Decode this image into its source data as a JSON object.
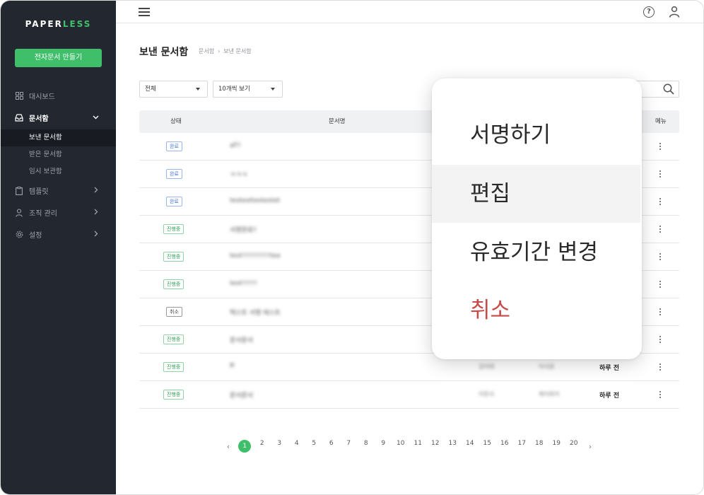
{
  "app": {
    "logo_main": "PAPER",
    "logo_accent": "LESS",
    "create_button": "전자문서 만들기"
  },
  "sidebar": {
    "items": [
      {
        "label": "대시보드",
        "icon": "dashboard-icon"
      },
      {
        "label": "문서함",
        "icon": "inbox-icon",
        "open": true
      },
      {
        "label": "템플릿",
        "icon": "clipboard-icon"
      },
      {
        "label": "조직 관리",
        "icon": "person-icon"
      },
      {
        "label": "설정",
        "icon": "gear-icon"
      }
    ],
    "sub_items": [
      {
        "label": "보낸 문서함",
        "active": true
      },
      {
        "label": "받은 문서함"
      },
      {
        "label": "임시 보관함"
      }
    ]
  },
  "topbar": {
    "help_symbol": "?"
  },
  "page": {
    "title": "보낸 문서함",
    "breadcrumb": [
      "문서함",
      "보낸 문서함"
    ]
  },
  "filters": {
    "status_select": "전체",
    "page_size_select": "10개씩 보기"
  },
  "table": {
    "headers": {
      "status": "상태",
      "name": "문서명",
      "menu": "메뉴"
    },
    "rows": [
      {
        "status": "완료",
        "kind": "done",
        "name": "af!!",
        "c3": "",
        "c4": "",
        "when": ""
      },
      {
        "status": "완료",
        "kind": "done",
        "name": "ㅋㅋㅋ",
        "c3": "",
        "c4": "",
        "when": ""
      },
      {
        "status": "완료",
        "kind": "done",
        "name": "testesttestestet",
        "c3": "",
        "c4": "",
        "when": ""
      },
      {
        "status": "진행중",
        "kind": "prog",
        "name": "서명완료?",
        "c3": "",
        "c4": "",
        "when": ""
      },
      {
        "status": "진행중",
        "kind": "prog",
        "name": "test!!!!!!!!!!!tea",
        "c3": "",
        "c4": "",
        "when": ""
      },
      {
        "status": "진행중",
        "kind": "prog",
        "name": "test!!!!!!",
        "c3": "",
        "c4": "",
        "when": ""
      },
      {
        "status": "취소",
        "kind": "cancel",
        "name": "텍스트 서명 테스트",
        "c3": "",
        "c4": "",
        "when": ""
      },
      {
        "status": "진행중",
        "kind": "prog",
        "name": "문서문서",
        "c3": "",
        "c4": "",
        "when": ""
      },
      {
        "status": "진행중",
        "kind": "prog",
        "name": "ff",
        "c3": "김이테",
        "c4": "이사원",
        "when": "하루 전"
      },
      {
        "status": "진행중",
        "kind": "prog",
        "name": "문서문서",
        "c3": "이문서",
        "c4": "제이파이",
        "when": "하루 전"
      }
    ]
  },
  "pagination": {
    "prev": "‹",
    "next": "›",
    "pages": [
      "1",
      "2",
      "3",
      "4",
      "5",
      "6",
      "7",
      "8",
      "9",
      "10",
      "11",
      "12",
      "13",
      "14",
      "15",
      "16",
      "17",
      "18",
      "19",
      "20"
    ],
    "current": "1"
  },
  "context_menu": {
    "items": [
      {
        "label": "서명하기"
      },
      {
        "label": "편집",
        "highlighted": true
      },
      {
        "label": "유효기간 변경"
      },
      {
        "label": "취소",
        "danger": true
      }
    ]
  },
  "colors": {
    "sidebar_bg": "#232830",
    "accent_green": "#3fbf6a",
    "badge_done": "#4a79d8",
    "badge_progress": "#2e9e56",
    "danger": "#c84a48"
  }
}
